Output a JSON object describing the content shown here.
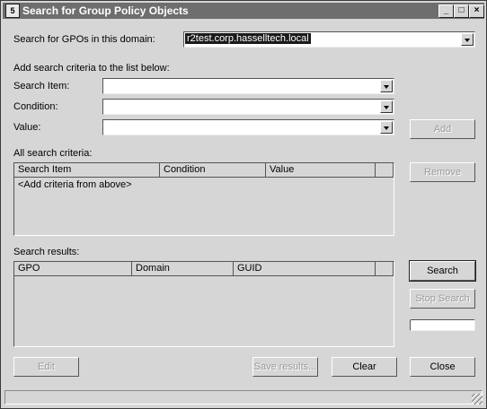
{
  "window": {
    "title": "Search for Group Policy Objects",
    "icon_glyph": "5",
    "minimize": "_",
    "maximize": "□",
    "close": "×"
  },
  "domain": {
    "label": "Search for GPOs in this domain:",
    "value": "r2test.corp.hasselltech.local"
  },
  "criteria_form": {
    "instruction": "Add search criteria to the list below:",
    "search_item_label": "Search Item:",
    "search_item_value": "",
    "condition_label": "Condition:",
    "condition_value": "",
    "value_label": "Value:",
    "value_value": "",
    "add_button": "Add"
  },
  "all_criteria": {
    "label": "All search criteria:",
    "columns": [
      "Search Item",
      "Condition",
      "Value"
    ],
    "placeholder_row": "<Add criteria from above>",
    "remove_button": "Remove"
  },
  "results": {
    "label": "Search results:",
    "columns": [
      "GPO",
      "Domain",
      "GUID"
    ],
    "search_button": "Search",
    "stop_button": "Stop Search"
  },
  "footer": {
    "edit_button": "Edit",
    "save_button": "Save results...",
    "clear_button": "Clear",
    "close_button": "Close"
  },
  "colors": {
    "titlebar": "#6e6e6e",
    "face": "#d6d6d6",
    "selection": "#1a1a1a"
  }
}
